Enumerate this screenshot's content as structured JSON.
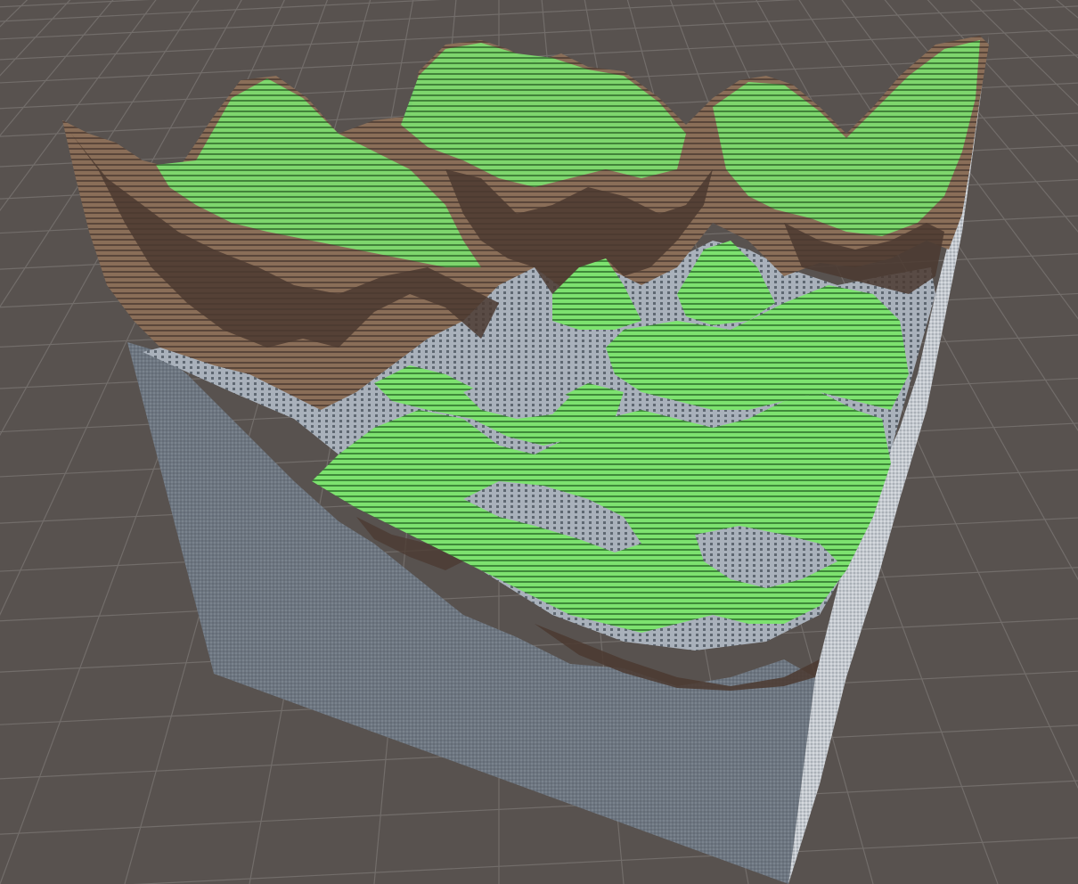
{
  "scene": {
    "view": "editor-scene-viewport",
    "object": "voxel-terrain-chunk",
    "palette": {
      "ground": "#58524f",
      "grid_line": "#6f6a67",
      "grass": "#7de26f",
      "grass_dark": "#4fa848",
      "dirt": "#9c7f68",
      "dirt_shadow": "#4b3a30",
      "stone": "#a8b0bb",
      "stone_dark": "#6d7681",
      "side_left": "#707983",
      "side_right": "#c6cbd0"
    }
  }
}
